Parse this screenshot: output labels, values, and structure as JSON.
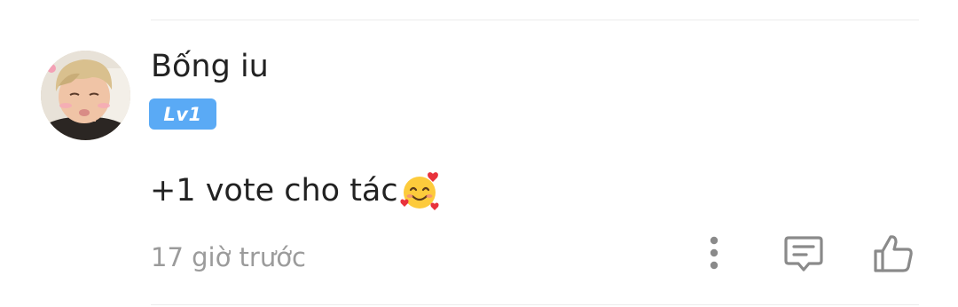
{
  "comment": {
    "username": "Bống iu",
    "level_badge": "Lv1",
    "text": "+1 vote cho tác",
    "emoji": "smiling-face-with-hearts-emoji",
    "timestamp": "17 giờ trước"
  },
  "actions": {
    "more_icon": "more-vertical-icon",
    "reply_icon": "comment-icon",
    "like_icon": "thumbs-up-icon"
  },
  "colors": {
    "badge_background": "#5aaaf5",
    "text_primary": "#222222",
    "text_secondary": "#9b9b9b",
    "icon_color": "#8a8a8a",
    "divider": "#ececec"
  }
}
